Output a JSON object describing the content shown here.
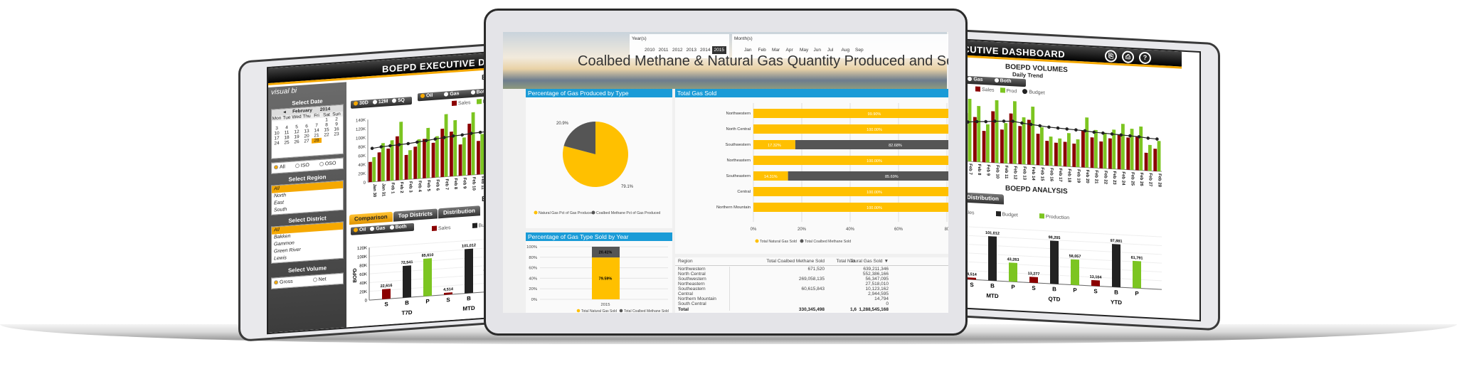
{
  "colors": {
    "accent": "#f5a800",
    "sales": "#8b0000",
    "prod": "#7cc521",
    "budget": "#222222",
    "pbi_blue": "#1a9bd7",
    "natural": "#ffc000",
    "coalbed": "#555555"
  },
  "exec_dashboard": {
    "logo": "visual bi",
    "title": "BOEPD EXECUTIVE DASHBOARD",
    "icons": [
      "export-icon",
      "print-icon",
      "help-icon"
    ],
    "sidebar": {
      "select_date": "Select Date",
      "calendar": {
        "month": "February",
        "year": "2014",
        "weekdays": [
          "Mon",
          "Tue",
          "Wed",
          "Thu",
          "Fri",
          "Sat",
          "Sun"
        ],
        "weeks": [
          [
            "",
            "",
            "",
            "",
            "",
            "1",
            "2"
          ],
          [
            "3",
            "4",
            "5",
            "6",
            "7",
            "8",
            "9"
          ],
          [
            "10",
            "11",
            "12",
            "13",
            "14",
            "15",
            "16"
          ],
          [
            "17",
            "18",
            "19",
            "20",
            "21",
            "22",
            "23"
          ],
          [
            "24",
            "25",
            "26",
            "27",
            "28",
            "",
            ""
          ]
        ],
        "selected": "28"
      },
      "scope_options": [
        "All",
        "ISO",
        "OSO"
      ],
      "scope_selected": "All",
      "select_region": "Select Region",
      "regions": [
        "All",
        "North",
        "East",
        "South"
      ],
      "select_district": "Select District",
      "districts": [
        "All",
        "Bakken",
        "Gammon",
        "Green River",
        "Lewis"
      ],
      "select_volume": "Select Volume",
      "volume_options": [
        "Gross",
        "Net"
      ],
      "volume_selected": "Gross"
    },
    "volumes_title": "BOEPD VOLUMES",
    "trend_title": "Daily Trend",
    "period_toggles": [
      "30D",
      "12M",
      "5Q"
    ],
    "period_selected": "30D",
    "product_toggles": [
      "Oil",
      "Gas",
      "Both"
    ],
    "product_selected": "Oil",
    "trend_legend": [
      "Sales",
      "Prod",
      "Budget"
    ],
    "analysis_title": "BOEPD ANALYSIS",
    "tabs": [
      "Comparison",
      "Top Districts",
      "Distribution"
    ],
    "tab_selected": "Comparison",
    "comparison_legend": [
      "Sales",
      "Budget",
      "Production"
    ],
    "comparison_ylabel": "BOPD"
  },
  "chart_data": [
    {
      "type": "bar",
      "title": "Daily Trend",
      "ylim": [
        0,
        140000
      ],
      "yticks": [
        "0",
        "20K",
        "40K",
        "60K",
        "80K",
        "100K",
        "120K",
        "140K"
      ],
      "categories": [
        "Jan 30",
        "Jan 31",
        "Feb 1",
        "Feb 2",
        "Feb 3",
        "Feb 4",
        "Feb 5",
        "Feb 6",
        "Feb 7",
        "Feb 8",
        "Feb 9",
        "Feb 10",
        "Feb 11",
        "Feb 12",
        "Feb 13",
        "Feb 14",
        "Feb 15",
        "Feb 16",
        "Feb 17",
        "Feb 18",
        "Feb 19",
        "Feb 20",
        "Feb 21",
        "Feb 22",
        "Feb 23",
        "Feb 24",
        "Feb 25",
        "Feb 26",
        "Feb 27",
        "Feb 28"
      ],
      "series": [
        {
          "name": "Sales",
          "values": [
            45000,
            65000,
            72000,
            98000,
            55000,
            72000,
            88000,
            78000,
            108000,
            100000,
            70000,
            115000,
            75000,
            112000,
            85000,
            100000,
            70000,
            55000,
            52000,
            55000,
            52000,
            82000,
            68000,
            60000,
            68000,
            78000,
            72000,
            75000,
            40000,
            50000
          ]
        },
        {
          "name": "Prod",
          "values": [
            55000,
            85000,
            90000,
            130000,
            65000,
            88000,
            112000,
            92000,
            140000,
            125000,
            85000,
            140000,
            90000,
            140000,
            105000,
            130000,
            85000,
            65000,
            62000,
            75000,
            62000,
            112000,
            85000,
            80000,
            88000,
            102000,
            92000,
            98000,
            58000,
            68000
          ]
        },
        {
          "name": "Budget",
          "values": [
            75000,
            77000,
            78000,
            79000,
            80000,
            82000,
            84000,
            86000,
            88000,
            90000,
            91000,
            93000,
            94000,
            95000,
            92000,
            90000,
            88000,
            86000,
            85000,
            84000,
            83000,
            82000,
            80000,
            79000,
            78000,
            77000,
            76000,
            75000,
            73000,
            72000
          ]
        }
      ]
    },
    {
      "type": "bar",
      "title": "BOEPD ANALYSIS - Comparison",
      "ylabel": "BOPD",
      "ylim": [
        0,
        120000
      ],
      "yticks": [
        "0",
        "20K",
        "40K",
        "60K",
        "80K",
        "100K",
        "120K"
      ],
      "groups": [
        "T7D",
        "MTD",
        "QTD",
        "YTD"
      ],
      "bar_labels": [
        "S",
        "B",
        "P"
      ],
      "series": [
        {
          "name": "Sales",
          "values": [
            22616,
            4514,
            13277,
            13104
          ],
          "labels": [
            "22,616",
            "4,514",
            "13,277",
            "13,104"
          ]
        },
        {
          "name": "Budget",
          "values": [
            72541,
            101012,
            98205,
            97881
          ],
          "labels": [
            "72,541",
            "101,012",
            "98,205",
            "97,881"
          ]
        },
        {
          "name": "Production",
          "values": [
            85610,
            43263,
            58057,
            61791
          ],
          "labels": [
            "85,610",
            "43,263",
            "58,057",
            "61,791"
          ]
        }
      ]
    },
    {
      "type": "pie",
      "title": "Percentage of Gas Produced by Type",
      "slices": [
        {
          "name": "Natural Gas Pct of Gas Produced",
          "value": 79.1,
          "label": "79.1%"
        },
        {
          "name": "Coalbed Methane Pct of Gas Produced",
          "value": 20.9,
          "label": "20.9%"
        }
      ]
    },
    {
      "type": "bar",
      "orientation": "horizontal",
      "stacked": true,
      "title": "Total Gas Sold",
      "xlim": [
        0,
        100
      ],
      "xticks": [
        "0%",
        "20%",
        "40%",
        "60%",
        "80"
      ],
      "categories": [
        "Northwestern",
        "North Central",
        "Southwestern",
        "Northeastern",
        "Southeastern",
        "Central",
        "Northern Mountain"
      ],
      "series": [
        {
          "name": "Total Natural Gas Sold",
          "values": [
            99.9,
            100,
            17.32,
            100,
            14.31,
            100,
            100
          ],
          "labels": [
            "99.90%",
            "100.00%",
            "17.32%",
            "100.00%",
            "14.31%",
            "100.00%",
            "100.00%"
          ]
        },
        {
          "name": "Total Coalbed Methane Sold",
          "values": [
            0.1,
            0,
            82.68,
            0,
            85.69,
            0,
            0
          ],
          "labels": [
            "",
            "",
            "82.68%",
            "",
            "85.69%",
            "",
            ""
          ]
        }
      ]
    },
    {
      "type": "bar",
      "stacked": true,
      "title": "Percentage of Gas Type Sold by Year",
      "ylim": [
        0,
        100
      ],
      "yticks": [
        "0%",
        "20%",
        "40%",
        "60%",
        "80%",
        "100%"
      ],
      "categories": [
        "2015"
      ],
      "series": [
        {
          "name": "Total Natural Gas Sold",
          "values": [
            79.59
          ],
          "labels": [
            "79.59%"
          ]
        },
        {
          "name": "Total Coalbed Methane Sold",
          "values": [
            20.41
          ],
          "labels": [
            "20.41%"
          ]
        }
      ]
    }
  ],
  "pbi": {
    "years_label": "Year(s)",
    "years": [
      "2010",
      "2011",
      "2012",
      "2013",
      "2014",
      "2015"
    ],
    "year_selected": "2015",
    "months_label": "Month(s)",
    "months": [
      "Jan",
      "Feb",
      "Mar",
      "Apr",
      "May",
      "Jun",
      "Jul",
      "Aug",
      "Sep"
    ],
    "title": "Coalbed Methane & Natural Gas Quantity Produced and Sold - MC",
    "table": {
      "headers": [
        "Region",
        "Total Coalbed Methane Sold",
        "Total Natural Gas Sold",
        "To"
      ],
      "sort_icon": "sort-desc-icon",
      "rows": [
        [
          "Northwestern",
          "671,520",
          "639,211,346"
        ],
        [
          "North Central",
          "",
          "552,386,166"
        ],
        [
          "Southwestern",
          "269,058,135",
          "56,347,095"
        ],
        [
          "Northeastern",
          "",
          "27,518,010"
        ],
        [
          "Southeastern",
          "60,615,843",
          "10,123,162"
        ],
        [
          "Central",
          "",
          "2,944,595"
        ],
        [
          "Northern Mountain",
          "",
          "14,794"
        ],
        [
          "South Central",
          "",
          "0"
        ]
      ],
      "total": [
        "Total",
        "330,345,498",
        "1,288,545,168",
        "1,6"
      ]
    }
  }
}
